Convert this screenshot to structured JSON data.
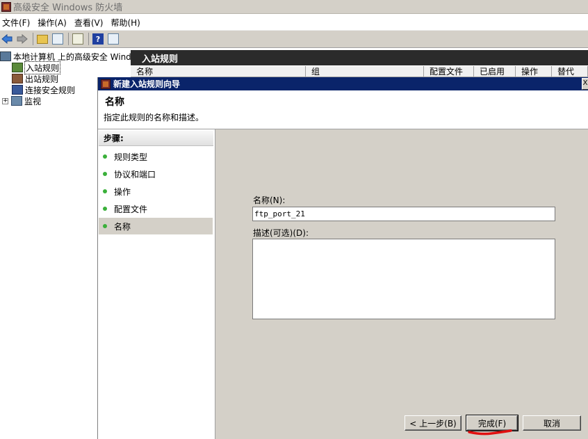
{
  "main_window": {
    "title": "高级安全 Windows 防火墙"
  },
  "menubar": {
    "items": [
      "文件(F)",
      "操作(A)",
      "查看(V)",
      "帮助(H)"
    ]
  },
  "toolbar": {
    "icons": [
      "back-arrow-icon",
      "forward-arrow-icon",
      "up-folder-icon",
      "show-hide-tree-icon",
      "export-icon",
      "help-icon",
      "properties-icon"
    ],
    "help_glyph": "?"
  },
  "tree": {
    "root": "本地计算机 上的高级安全 Windows",
    "items": [
      "入站规则",
      "出站规则",
      "连接安全规则",
      "监视"
    ],
    "expander": "+"
  },
  "right_pane": {
    "header": "入站规则",
    "columns": [
      "名称",
      "组",
      "配置文件",
      "已启用",
      "操作",
      "替代"
    ]
  },
  "wizard": {
    "title": "新建入站规则向导",
    "close_glyph": "X",
    "page_title": "名称",
    "page_desc": "指定此规则的名称和描述。",
    "steps_title": "步骤:",
    "steps": [
      "规则类型",
      "协议和端口",
      "操作",
      "配置文件",
      "名称"
    ],
    "active_step": 4,
    "name_label": "名称(N):",
    "name_value": "ftp_port_21",
    "desc_label": "描述(可选)(D):",
    "desc_value": "",
    "buttons": {
      "back": "< 上一步(B)",
      "finish": "完成(F)",
      "cancel": "取消"
    }
  },
  "colors": {
    "title_bar": "#0a246a",
    "dialog_bg": "#d4d0c8",
    "annotation": "#e01010",
    "step_dot": "#3ab03a"
  }
}
